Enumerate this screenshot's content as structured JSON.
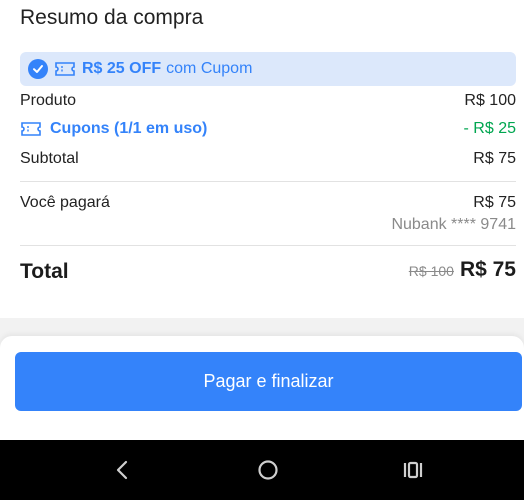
{
  "summary": {
    "title": "Resumo da compra",
    "coupon_banner": {
      "strong": "R$ 25 OFF",
      "light": "com Cupom"
    },
    "product": {
      "label": "Produto",
      "value": "R$ 100"
    },
    "coupons": {
      "label": "Cupons (1/1 em uso)",
      "value": "- R$ 25"
    },
    "subtotal": {
      "label": "Subtotal",
      "value": "R$ 75"
    },
    "pay": {
      "label": "Você pagará",
      "value": "R$ 75",
      "method": "Nubank **** 9741"
    },
    "total": {
      "label": "Total",
      "old": "R$ 100",
      "new": "R$ 75"
    }
  },
  "footer": {
    "pay_button": "Pagar e finalizar"
  },
  "colors": {
    "accent": "#3483fa",
    "discount": "#00a650",
    "banner_bg": "#dce8fb"
  },
  "navbar": {
    "icons": [
      "back-icon",
      "home-icon",
      "recent-apps-icon"
    ]
  }
}
